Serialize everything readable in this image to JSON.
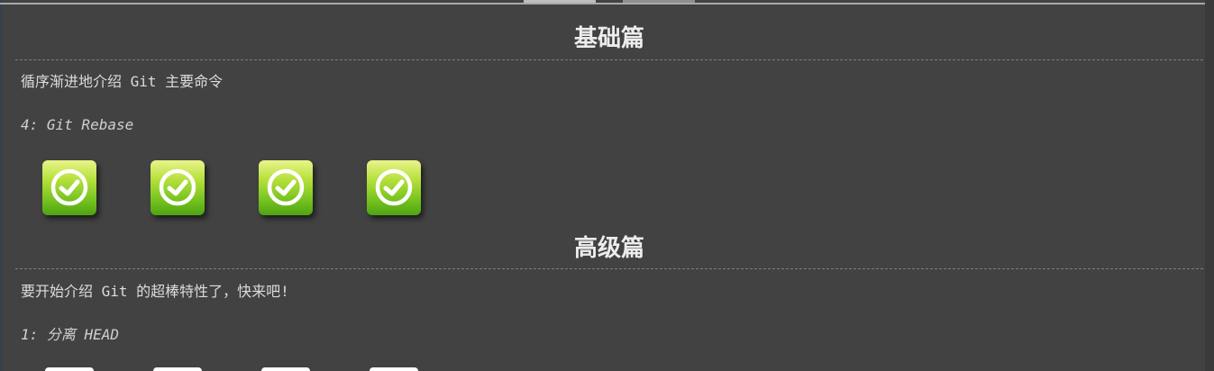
{
  "basic": {
    "title": "基础篇",
    "intro": "循序渐进地介绍 Git 主要命令",
    "level_title": "4: Git Rebase",
    "levels": [
      {
        "status": "completed",
        "icon": "check-circle-icon"
      },
      {
        "status": "completed",
        "icon": "check-circle-icon"
      },
      {
        "status": "completed",
        "icon": "check-circle-icon"
      },
      {
        "status": "completed",
        "icon": "check-circle-icon"
      }
    ]
  },
  "advanced": {
    "title": "高级篇",
    "intro": "要开始介绍 Git 的超棒特性了，快来吧!",
    "level_title": "1: 分离 HEAD",
    "levels": [
      {
        "status": "pending"
      },
      {
        "status": "pending"
      },
      {
        "status": "pending"
      },
      {
        "status": "pending"
      }
    ]
  },
  "colors": {
    "background": "#424242",
    "completed_green": "#6cbf1e",
    "text": "#e0e0e0"
  }
}
